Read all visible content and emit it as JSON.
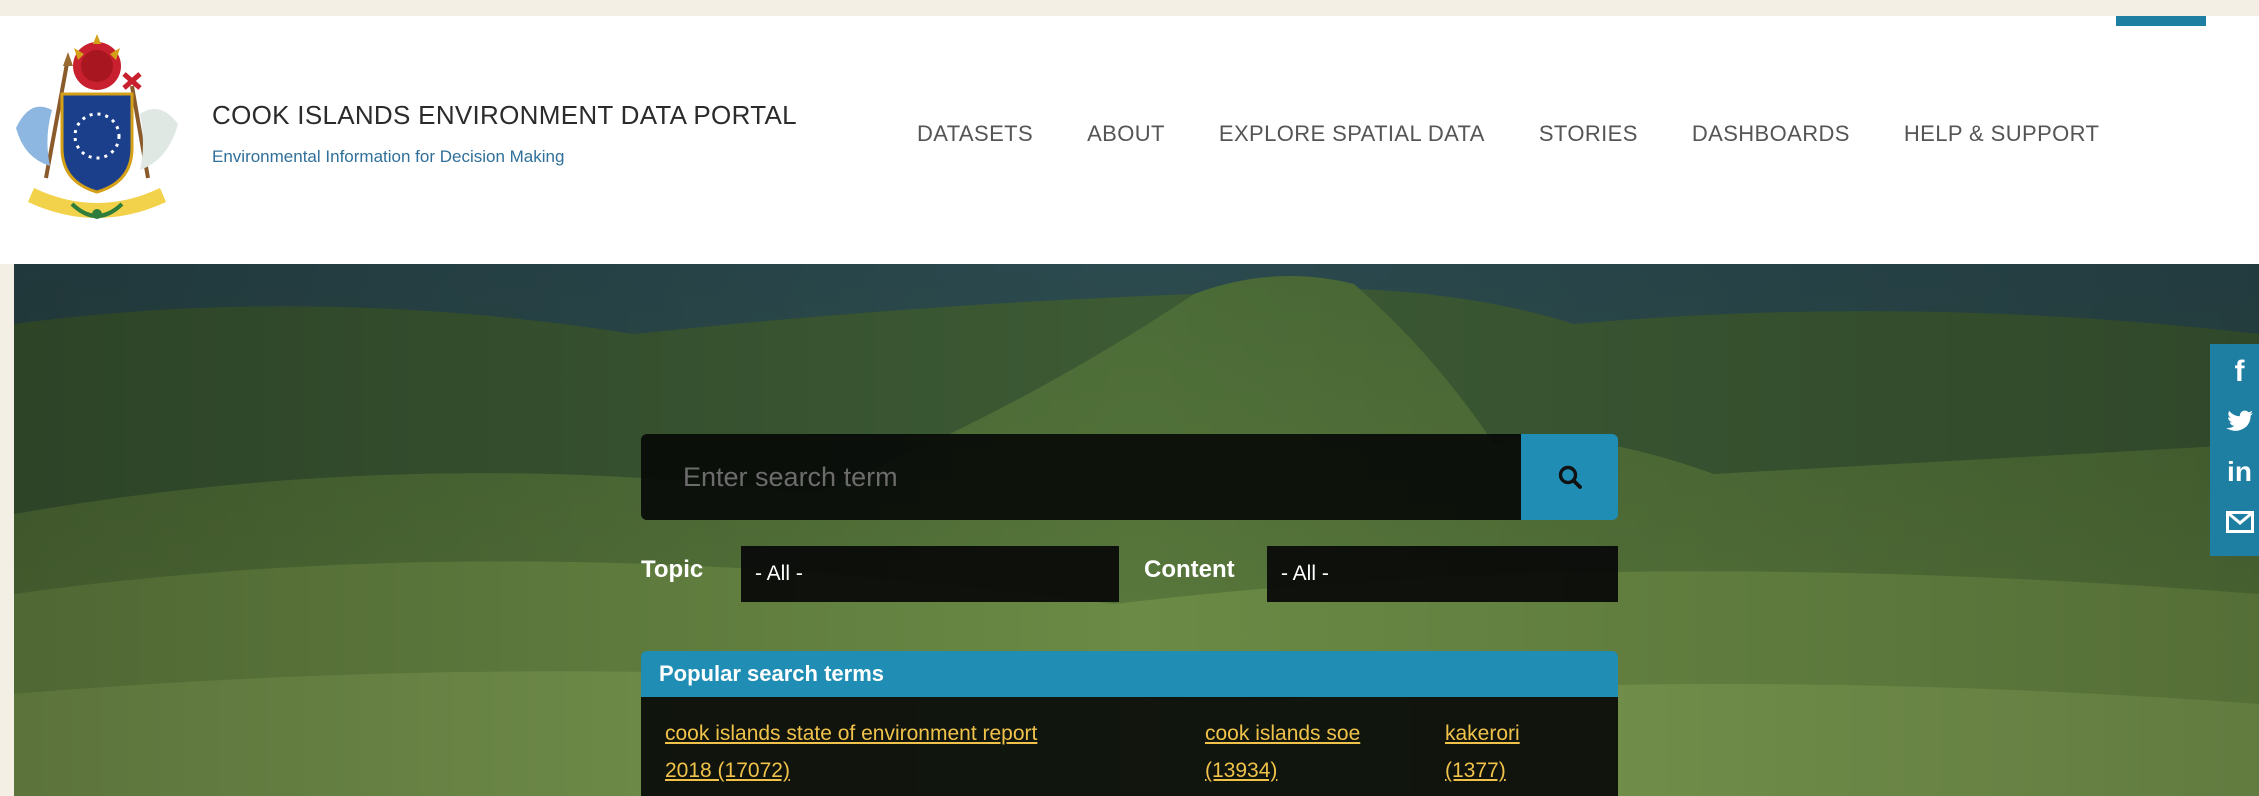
{
  "brand": {
    "title": "COOK ISLANDS ENVIRONMENT DATA PORTAL",
    "subtitle": "Environmental Information for Decision Making"
  },
  "nav": {
    "items": [
      {
        "label": "DATASETS"
      },
      {
        "label": "ABOUT"
      },
      {
        "label": "EXPLORE SPATIAL DATA"
      },
      {
        "label": "STORIES"
      },
      {
        "label": "DASHBOARDS"
      },
      {
        "label": "HELP & SUPPORT"
      }
    ]
  },
  "search": {
    "placeholder": "Enter search term",
    "button_icon": "search-icon"
  },
  "filters": {
    "topic_label": "Topic",
    "topic_value": "- All -",
    "content_label": "Content",
    "content_value": "- All -"
  },
  "popular": {
    "header": "Popular search terms",
    "terms": [
      {
        "label": "cook islands state of environment report",
        "count": "2018 (17072)"
      },
      {
        "label": "cook islands soe",
        "count": "(13934)"
      },
      {
        "label": "kakerori",
        "count": "(1377)"
      }
    ]
  },
  "social": {
    "icons": [
      "facebook-icon",
      "twitter-icon",
      "linkedin-icon",
      "email-icon"
    ],
    "facebook_glyph": "f",
    "linkedin_glyph": "in"
  },
  "colors": {
    "accent": "#1f8db4",
    "brand_blue": "#2f6f99",
    "link": "#f0c24a",
    "page_background": "#f3efe4"
  }
}
